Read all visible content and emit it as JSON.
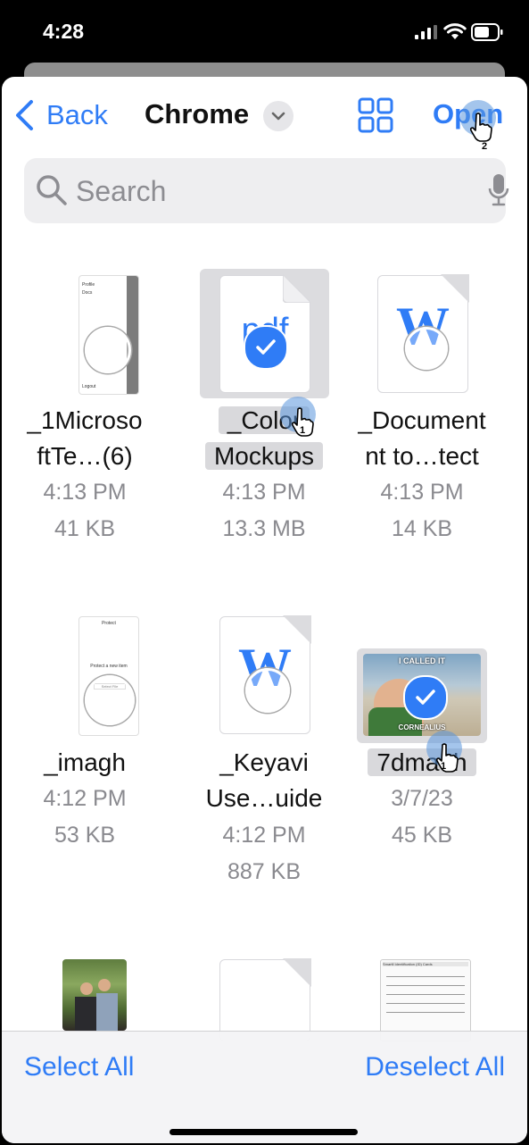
{
  "status": {
    "time": "4:28"
  },
  "nav": {
    "back": "Back",
    "title": "Chrome",
    "open": "Open"
  },
  "search": {
    "placeholder": "Search"
  },
  "files": [
    {
      "name1": "_1Microso",
      "name2": "ftTe…(6)",
      "time": "4:13 PM",
      "size": "41 KB",
      "selected": false
    },
    {
      "name1": "_Color",
      "name2": "Mockups",
      "time": "4:13 PM",
      "size": "13.3 MB",
      "selected": true
    },
    {
      "name1": "_Document",
      "name2": "nt to…tect",
      "time": "4:13 PM",
      "size": "14 KB",
      "selected": false
    },
    {
      "name1": "_imagh",
      "time": "4:12 PM",
      "size": "53 KB",
      "selected": false
    },
    {
      "name1": "_Keyavi",
      "name2": "Use…uide",
      "time": "4:12 PM",
      "size": "887 KB",
      "selected": false
    },
    {
      "name1": "7dma5h",
      "time": "3/7/23",
      "size": "45 KB",
      "selected": true
    }
  ],
  "thumbs": {
    "profile_label": "Profile",
    "docs_label": "Docs",
    "logout_label": "Logout",
    "pdf_label": "pdf",
    "word_label": "W",
    "protect_title": "Protect",
    "protect_text": "Protect a new item",
    "protect_btn": "Select File",
    "meme_top": "I CALLED IT",
    "meme_bottom": "CORNEALIUS",
    "form_title": "Smartll Identification (ID) Cards"
  },
  "cursors": {
    "first": "1",
    "second": "2"
  },
  "toolbar": {
    "select_all": "Select All",
    "deselect_all": "Deselect All"
  },
  "colors": {
    "accent": "#2f7cf6",
    "selection": "#d9d9dc"
  }
}
